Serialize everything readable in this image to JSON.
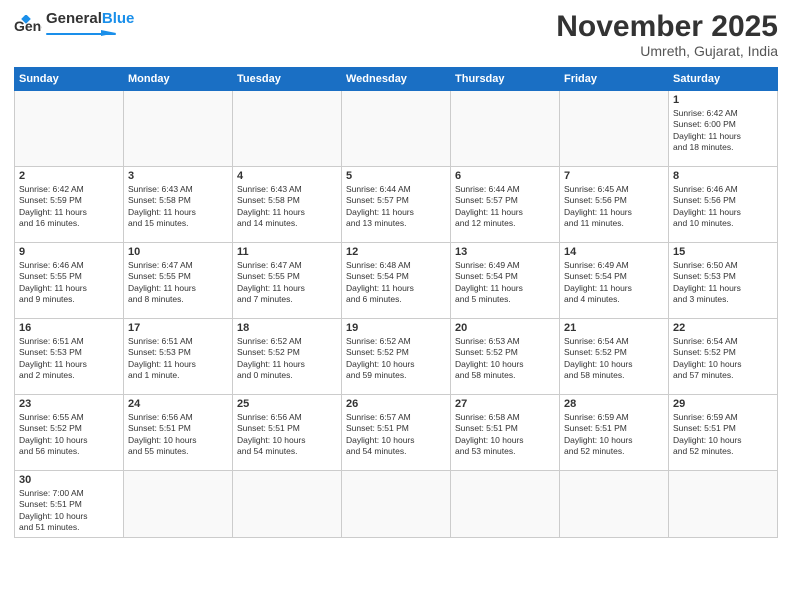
{
  "logo": {
    "text_general": "General",
    "text_blue": "Blue"
  },
  "title": "November 2025",
  "subtitle": "Umreth, Gujarat, India",
  "days_of_week": [
    "Sunday",
    "Monday",
    "Tuesday",
    "Wednesday",
    "Thursday",
    "Friday",
    "Saturday"
  ],
  "weeks": [
    [
      {
        "day": "",
        "info": ""
      },
      {
        "day": "",
        "info": ""
      },
      {
        "day": "",
        "info": ""
      },
      {
        "day": "",
        "info": ""
      },
      {
        "day": "",
        "info": ""
      },
      {
        "day": "",
        "info": ""
      },
      {
        "day": "1",
        "info": "Sunrise: 6:42 AM\nSunset: 6:00 PM\nDaylight: 11 hours\nand 18 minutes."
      }
    ],
    [
      {
        "day": "2",
        "info": "Sunrise: 6:42 AM\nSunset: 5:59 PM\nDaylight: 11 hours\nand 16 minutes."
      },
      {
        "day": "3",
        "info": "Sunrise: 6:43 AM\nSunset: 5:58 PM\nDaylight: 11 hours\nand 15 minutes."
      },
      {
        "day": "4",
        "info": "Sunrise: 6:43 AM\nSunset: 5:58 PM\nDaylight: 11 hours\nand 14 minutes."
      },
      {
        "day": "5",
        "info": "Sunrise: 6:44 AM\nSunset: 5:57 PM\nDaylight: 11 hours\nand 13 minutes."
      },
      {
        "day": "6",
        "info": "Sunrise: 6:44 AM\nSunset: 5:57 PM\nDaylight: 11 hours\nand 12 minutes."
      },
      {
        "day": "7",
        "info": "Sunrise: 6:45 AM\nSunset: 5:56 PM\nDaylight: 11 hours\nand 11 minutes."
      },
      {
        "day": "8",
        "info": "Sunrise: 6:46 AM\nSunset: 5:56 PM\nDaylight: 11 hours\nand 10 minutes."
      }
    ],
    [
      {
        "day": "9",
        "info": "Sunrise: 6:46 AM\nSunset: 5:55 PM\nDaylight: 11 hours\nand 9 minutes."
      },
      {
        "day": "10",
        "info": "Sunrise: 6:47 AM\nSunset: 5:55 PM\nDaylight: 11 hours\nand 8 minutes."
      },
      {
        "day": "11",
        "info": "Sunrise: 6:47 AM\nSunset: 5:55 PM\nDaylight: 11 hours\nand 7 minutes."
      },
      {
        "day": "12",
        "info": "Sunrise: 6:48 AM\nSunset: 5:54 PM\nDaylight: 11 hours\nand 6 minutes."
      },
      {
        "day": "13",
        "info": "Sunrise: 6:49 AM\nSunset: 5:54 PM\nDaylight: 11 hours\nand 5 minutes."
      },
      {
        "day": "14",
        "info": "Sunrise: 6:49 AM\nSunset: 5:54 PM\nDaylight: 11 hours\nand 4 minutes."
      },
      {
        "day": "15",
        "info": "Sunrise: 6:50 AM\nSunset: 5:53 PM\nDaylight: 11 hours\nand 3 minutes."
      }
    ],
    [
      {
        "day": "16",
        "info": "Sunrise: 6:51 AM\nSunset: 5:53 PM\nDaylight: 11 hours\nand 2 minutes."
      },
      {
        "day": "17",
        "info": "Sunrise: 6:51 AM\nSunset: 5:53 PM\nDaylight: 11 hours\nand 1 minute."
      },
      {
        "day": "18",
        "info": "Sunrise: 6:52 AM\nSunset: 5:52 PM\nDaylight: 11 hours\nand 0 minutes."
      },
      {
        "day": "19",
        "info": "Sunrise: 6:52 AM\nSunset: 5:52 PM\nDaylight: 10 hours\nand 59 minutes."
      },
      {
        "day": "20",
        "info": "Sunrise: 6:53 AM\nSunset: 5:52 PM\nDaylight: 10 hours\nand 58 minutes."
      },
      {
        "day": "21",
        "info": "Sunrise: 6:54 AM\nSunset: 5:52 PM\nDaylight: 10 hours\nand 58 minutes."
      },
      {
        "day": "22",
        "info": "Sunrise: 6:54 AM\nSunset: 5:52 PM\nDaylight: 10 hours\nand 57 minutes."
      }
    ],
    [
      {
        "day": "23",
        "info": "Sunrise: 6:55 AM\nSunset: 5:52 PM\nDaylight: 10 hours\nand 56 minutes."
      },
      {
        "day": "24",
        "info": "Sunrise: 6:56 AM\nSunset: 5:51 PM\nDaylight: 10 hours\nand 55 minutes."
      },
      {
        "day": "25",
        "info": "Sunrise: 6:56 AM\nSunset: 5:51 PM\nDaylight: 10 hours\nand 54 minutes."
      },
      {
        "day": "26",
        "info": "Sunrise: 6:57 AM\nSunset: 5:51 PM\nDaylight: 10 hours\nand 54 minutes."
      },
      {
        "day": "27",
        "info": "Sunrise: 6:58 AM\nSunset: 5:51 PM\nDaylight: 10 hours\nand 53 minutes."
      },
      {
        "day": "28",
        "info": "Sunrise: 6:59 AM\nSunset: 5:51 PM\nDaylight: 10 hours\nand 52 minutes."
      },
      {
        "day": "29",
        "info": "Sunrise: 6:59 AM\nSunset: 5:51 PM\nDaylight: 10 hours\nand 52 minutes."
      }
    ],
    [
      {
        "day": "30",
        "info": "Sunrise: 7:00 AM\nSunset: 5:51 PM\nDaylight: 10 hours\nand 51 minutes."
      },
      {
        "day": "",
        "info": ""
      },
      {
        "day": "",
        "info": ""
      },
      {
        "day": "",
        "info": ""
      },
      {
        "day": "",
        "info": ""
      },
      {
        "day": "",
        "info": ""
      },
      {
        "day": "",
        "info": ""
      }
    ]
  ]
}
